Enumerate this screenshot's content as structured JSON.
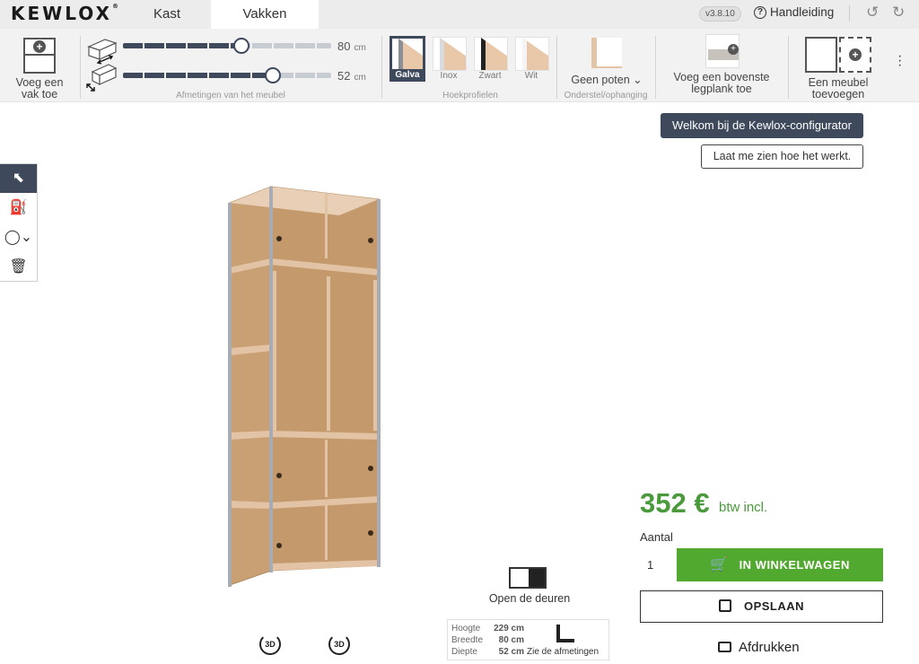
{
  "brand": {
    "logo_text": "KEWLOX",
    "logo_mark": "®"
  },
  "tabs": [
    {
      "label": "Kast"
    },
    {
      "label": "Vakken"
    }
  ],
  "version": "v3.8.10",
  "help_label": "Handleiding",
  "toolbar": {
    "add_compartment_label": "Voeg een vak toe",
    "dimensions": {
      "caption": "Afmetingen van het meubel",
      "width_value": "80",
      "depth_value": "52",
      "unit": "cm",
      "width_fraction": 0.57,
      "depth_fraction": 0.72
    },
    "profiles": {
      "caption": "Hoekprofielen",
      "items": [
        {
          "label": "Galva",
          "selected": true,
          "edge_color": "#8a8f96"
        },
        {
          "label": "Inox",
          "selected": false,
          "edge_color": "#d8dadc"
        },
        {
          "label": "Zwart",
          "selected": false,
          "edge_color": "#222222"
        },
        {
          "label": "Wit",
          "selected": false,
          "edge_color": "#f4f4f4"
        }
      ]
    },
    "stand": {
      "value": "Geen poten",
      "caption": "Onderstel/ophanging"
    },
    "top_shelf_label": "Voeg een bovenste legplank toe",
    "add_furniture_label": "Een meubel toevoegen"
  },
  "palette": [
    {
      "icon": "select-cursor-icon",
      "selected": true
    },
    {
      "icon": "paint-bucket-icon",
      "selected": false
    },
    {
      "icon": "handle-picker-icon",
      "selected": false
    },
    {
      "icon": "trash-icon",
      "selected": false
    }
  ],
  "welcome": {
    "title": "Welkom bij de Kewlox-configurator",
    "cta": "Laat me zien hoe het werkt."
  },
  "viewer": {
    "open_doors_label": "Open de deuren",
    "rotate_label": "3D",
    "dimensions": [
      {
        "label": "Hoogte",
        "value": "229 cm"
      },
      {
        "label": "Breedte",
        "value": "80 cm"
      },
      {
        "label": "Diepte",
        "value": "52 cm"
      }
    ],
    "see_dimensions_label": "Zie de afmetingen"
  },
  "purchase": {
    "price": "352 €",
    "price_suffix": "btw incl.",
    "quantity_label": "Aantal",
    "quantity": "1",
    "cart_label": "IN WINKELWAGEN",
    "save_label": "OPSLAAN",
    "print_label": "Afdrukken"
  },
  "colors": {
    "accent_dark": "#3e4a5c",
    "price_green": "#4a9a3c",
    "cart_green": "#52a92f",
    "wood": "#c49a6c",
    "edge": "#e3c3a5"
  }
}
